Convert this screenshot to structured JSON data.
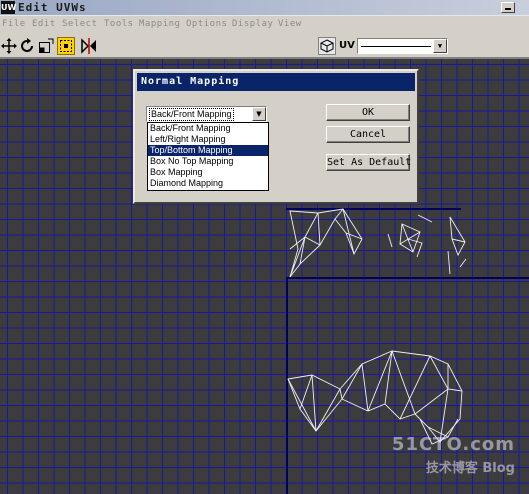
{
  "window": {
    "title": "Edit UVWs",
    "icon_text": "UW"
  },
  "menu": [
    "File",
    "Edit",
    "Select",
    "Tools",
    "Mapping",
    "Options",
    "Display",
    "View"
  ],
  "toolbar": {
    "tools": [
      "move-icon",
      "rotate-icon",
      "scale-icon",
      "pick-icon",
      "mirror-icon"
    ],
    "channel_label": "UV"
  },
  "watermark": {
    "site": "51CTO.com",
    "blog": "技术博客  Blog"
  },
  "dialog": {
    "title": "Normal Mapping",
    "selected_value": "Back/Front Mapping",
    "options": [
      "Back/Front Mapping",
      "Left/Right Mapping",
      "Top/Bottom Mapping",
      "Box No Top Mapping",
      "Box Mapping",
      "Diamond Mapping"
    ],
    "highlighted_option": "Top/Bottom Mapping",
    "ok_label": "OK",
    "cancel_label": "Cancel",
    "default_label": "Set As Default"
  },
  "colors": {
    "grid_line": "#1818a0",
    "viewport_bg": "#3c3c3c",
    "selection": "#0a246a",
    "active_tool": "#ffd200"
  }
}
